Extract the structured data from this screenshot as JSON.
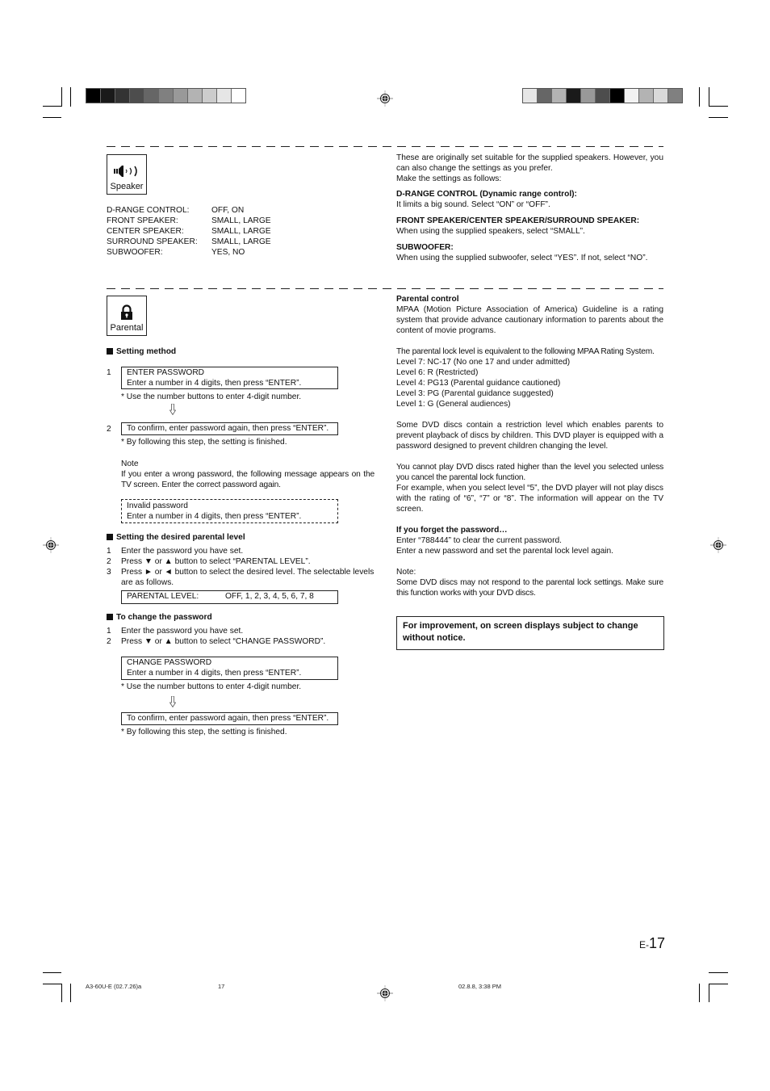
{
  "print_marks": {
    "left_swatches": [
      "#000000",
      "#1a1a1a",
      "#333333",
      "#4d4d4d",
      "#666666",
      "#808080",
      "#999999",
      "#b3b3b3",
      "#cccccc",
      "#e6e6e6",
      "#ffffff"
    ],
    "right_swatches": [
      "#e6e6e6",
      "#666666",
      "#b3b3b3",
      "#1a1a1a",
      "#999999",
      "#4d4d4d",
      "#000000",
      "#f2f2f2",
      "#b3b3b3",
      "#d9d9d9",
      "#808080"
    ]
  },
  "speaker_section": {
    "icon_label": "Speaker",
    "icon": "speaker-icon",
    "settings": [
      {
        "key": "D-RANGE CONTROL:",
        "value": "OFF, ON"
      },
      {
        "key": "FRONT SPEAKER:",
        "value": "SMALL, LARGE"
      },
      {
        "key": "CENTER SPEAKER:",
        "value": "SMALL, LARGE"
      },
      {
        "key": "SURROUND SPEAKER:",
        "value": "SMALL, LARGE"
      },
      {
        "key": "SUBWOOFER:",
        "value": "YES, NO"
      }
    ],
    "intro_line1": "These are originally set suitable for the supplied speakers. However,  you can also change the settings as you prefer.",
    "intro_line2": "Make the settings as follows:",
    "drange_heading": "D-RANGE CONTROL (Dynamic range control):",
    "drange_text": "It limits a big sound. Select “ON” or “OFF”.",
    "speakers_heading": "FRONT SPEAKER/CENTER SPEAKER/SURROUND SPEAKER:",
    "speakers_text": "When using the supplied speakers, select “SMALL”.",
    "subwoofer_heading": "SUBWOOFER:",
    "subwoofer_text": "When using the supplied subwoofer, select “YES”. If not, select “NO”."
  },
  "parental_section": {
    "icon_label": "Parental",
    "icon": "lock-icon",
    "setting_method": {
      "heading": "Setting method",
      "step1_num": "1",
      "step1_box_line1": "ENTER PASSWORD",
      "step1_box_line2": "Enter a number in 4 digits, then press “ENTER”.",
      "step1_note": "* Use the number buttons to enter 4-digit number.",
      "step2_num": "2",
      "step2_box": "To confirm, enter password again, then press “ENTER”.",
      "step2_note": "* By following this step, the setting is finished.",
      "note_label": "Note",
      "note_text": "If you enter a wrong password, the following message appears on the TV screen. Enter the correct password again.",
      "invalid_line1": "Invalid password",
      "invalid_line2": "Enter a number in 4 digits, then press “ENTER”."
    },
    "desired_level": {
      "heading": "Setting the desired parental level",
      "steps": [
        {
          "n": "1",
          "text": "Enter the password you have set."
        },
        {
          "n": "2",
          "text": "Press ▼ or ▲ button to select “PARENTAL LEVEL”."
        },
        {
          "n": "3",
          "text": "Press ► or ◄ button to select the desired level. The selectable levels are as follows."
        }
      ],
      "box_key": "PARENTAL LEVEL:",
      "box_value": "OFF, 1, 2, 3, 4, 5, 6, 7, 8"
    },
    "change_password": {
      "heading": "To change the password",
      "steps": [
        {
          "n": "1",
          "text": "Enter the password you have set."
        },
        {
          "n": "2",
          "text": "Press ▼ or ▲ button to select “CHANGE PASSWORD”."
        }
      ],
      "box_line1": "CHANGE PASSWORD",
      "box_line2": "Enter a number in 4 digits, then press “ENTER”.",
      "box_note": "* Use the number buttons to enter 4-digit number.",
      "confirm_box": "To confirm, enter password again, then press “ENTER”.",
      "confirm_note": "* By following this step, the setting is finished."
    },
    "right": {
      "control_heading": "Parental control",
      "mpaa_text": "MPAA (Motion Picture Association of America) Guideline is a rating system that provide advance cautionary information to parents about the content of movie programs.",
      "equiv_text": "The parental lock level is equivalent to the following MPAA Rating System.",
      "levels": [
        "Level 7: NC-17 (No one 17 and under admitted)",
        "Level 6: R (Restricted)",
        "Level 4: PG13 (Parental guidance cautioned)",
        "Level 3: PG (Parental guidance suggested)",
        "Level 1: G (General audiences)"
      ],
      "restriction_text": "Some DVD discs contain a restriction level which enables parents to prevent playback of discs by children. This DVD player is equipped with a password designed to prevent children changing the level.",
      "cannot_play_text": "You cannot play DVD discs rated higher than the level you selected unless you cancel the parental lock function.",
      "example_text": "For example, when you select level “5”, the DVD player will not play discs with the rating of “6”, “7” or “8”. The information will appear on the TV screen.",
      "forget_heading": "If you forget the password…",
      "forget_line1": "Enter “788444” to clear the current password.",
      "forget_line2": "Enter a new password and set the parental lock level again.",
      "note_label": "Note:",
      "note_text": "Some DVD discs may not respond to the parental lock settings. Make sure this function works with your DVD discs.",
      "notice": "For improvement, on screen displays subject to change without notice."
    }
  },
  "page_number_prefix": "E-",
  "page_number": "17",
  "footer": {
    "file_code": "A3-60U-E (02.7.26)a",
    "page": "17",
    "timestamp": "02.8.8, 3:38 PM"
  }
}
